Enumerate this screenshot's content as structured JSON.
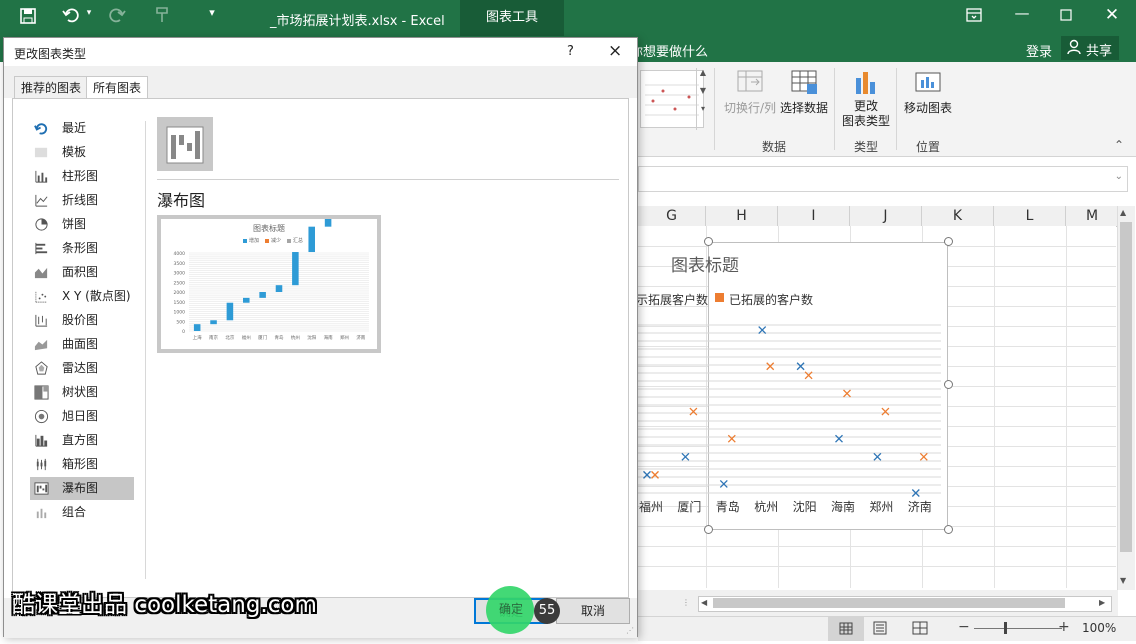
{
  "app": {
    "title": "_市场拓展计划表.xlsx - Excel",
    "context_tab": "图表工具",
    "tell_me": "你想要做什么",
    "signin": "登录",
    "share": "共享",
    "accent": "#217346"
  },
  "ribbon": {
    "buttons": [
      {
        "label": "切换行/列",
        "enabled": false
      },
      {
        "label": "选择数据",
        "enabled": true
      },
      {
        "label": "更改\n图表类型",
        "enabled": true
      },
      {
        "label": "移动图表",
        "enabled": true
      }
    ],
    "groups": [
      "数据",
      "类型",
      "位置"
    ]
  },
  "sheet": {
    "columns": [
      "G",
      "H",
      "I",
      "J",
      "K",
      "L",
      "M"
    ],
    "zoom": "100%"
  },
  "chart": {
    "title": "图表标题",
    "legend": [
      {
        "name": "未拓展客户数",
        "shown": "示拓展客户数",
        "color": "#2e75b6"
      },
      {
        "name": "已拓展的客户数",
        "shown": "已拓展的客户数",
        "color": "#ed7d31"
      }
    ]
  },
  "chart_data": {
    "type": "scatter",
    "title": "图表标题",
    "categories": [
      "福州",
      "厦门",
      "青岛",
      "杭州",
      "沈阳",
      "海南",
      "郑州",
      "济南"
    ],
    "series": [
      {
        "name": "示拓展客户数",
        "color": "#2e75b6",
        "values": [
          2,
          4,
          1,
          18,
          14,
          6,
          4,
          0
        ]
      },
      {
        "name": "已拓展的客户数",
        "color": "#ed7d31",
        "values": [
          2,
          9,
          6,
          14,
          13,
          11,
          9,
          4
        ]
      }
    ],
    "ylim": [
      0,
      19
    ],
    "grid": true,
    "legend_position": "top"
  },
  "dialog": {
    "title": "更改图表类型",
    "help": "?",
    "close": "×",
    "tabs": [
      "推荐的图表",
      "所有图表"
    ],
    "active_tab": 1,
    "categories": [
      {
        "label": "最近",
        "icon": "recent-icon"
      },
      {
        "label": "模板",
        "icon": "template-icon"
      },
      {
        "label": "柱形图",
        "icon": "column-chart-icon"
      },
      {
        "label": "折线图",
        "icon": "line-chart-icon"
      },
      {
        "label": "饼图",
        "icon": "pie-chart-icon"
      },
      {
        "label": "条形图",
        "icon": "bar-chart-icon"
      },
      {
        "label": "面积图",
        "icon": "area-chart-icon"
      },
      {
        "label": "X Y (散点图)",
        "icon": "scatter-chart-icon"
      },
      {
        "label": "股价图",
        "icon": "stock-chart-icon"
      },
      {
        "label": "曲面图",
        "icon": "surface-chart-icon"
      },
      {
        "label": "雷达图",
        "icon": "radar-chart-icon"
      },
      {
        "label": "树状图",
        "icon": "treemap-chart-icon"
      },
      {
        "label": "旭日图",
        "icon": "sunburst-chart-icon"
      },
      {
        "label": "直方图",
        "icon": "histogram-chart-icon"
      },
      {
        "label": "箱形图",
        "icon": "box-chart-icon"
      },
      {
        "label": "瀑布图",
        "icon": "waterfall-chart-icon"
      },
      {
        "label": "组合",
        "icon": "combo-chart-icon"
      }
    ],
    "selected_category": "瀑布图",
    "subtype_heading": "瀑布图",
    "preview": {
      "title": "图表标题",
      "legend": [
        "增加",
        "减少",
        "汇总"
      ],
      "y_ticks": [
        "4000",
        "3500",
        "3000",
        "2500",
        "2000",
        "1500",
        "1000",
        "500",
        "0"
      ],
      "x_labels": [
        "上海",
        "南京",
        "北京",
        "福州",
        "厦门",
        "青岛",
        "杭州",
        "沈阳",
        "海南",
        "郑州",
        "济南"
      ],
      "steps": [
        350,
        200,
        900,
        250,
        300,
        350,
        1700,
        1300,
        600,
        300,
        150
      ]
    },
    "ok": "确定",
    "cancel": "取消"
  },
  "overlay": {
    "watermark": "酷课堂出品 coolketang.com",
    "click_count": "55"
  }
}
